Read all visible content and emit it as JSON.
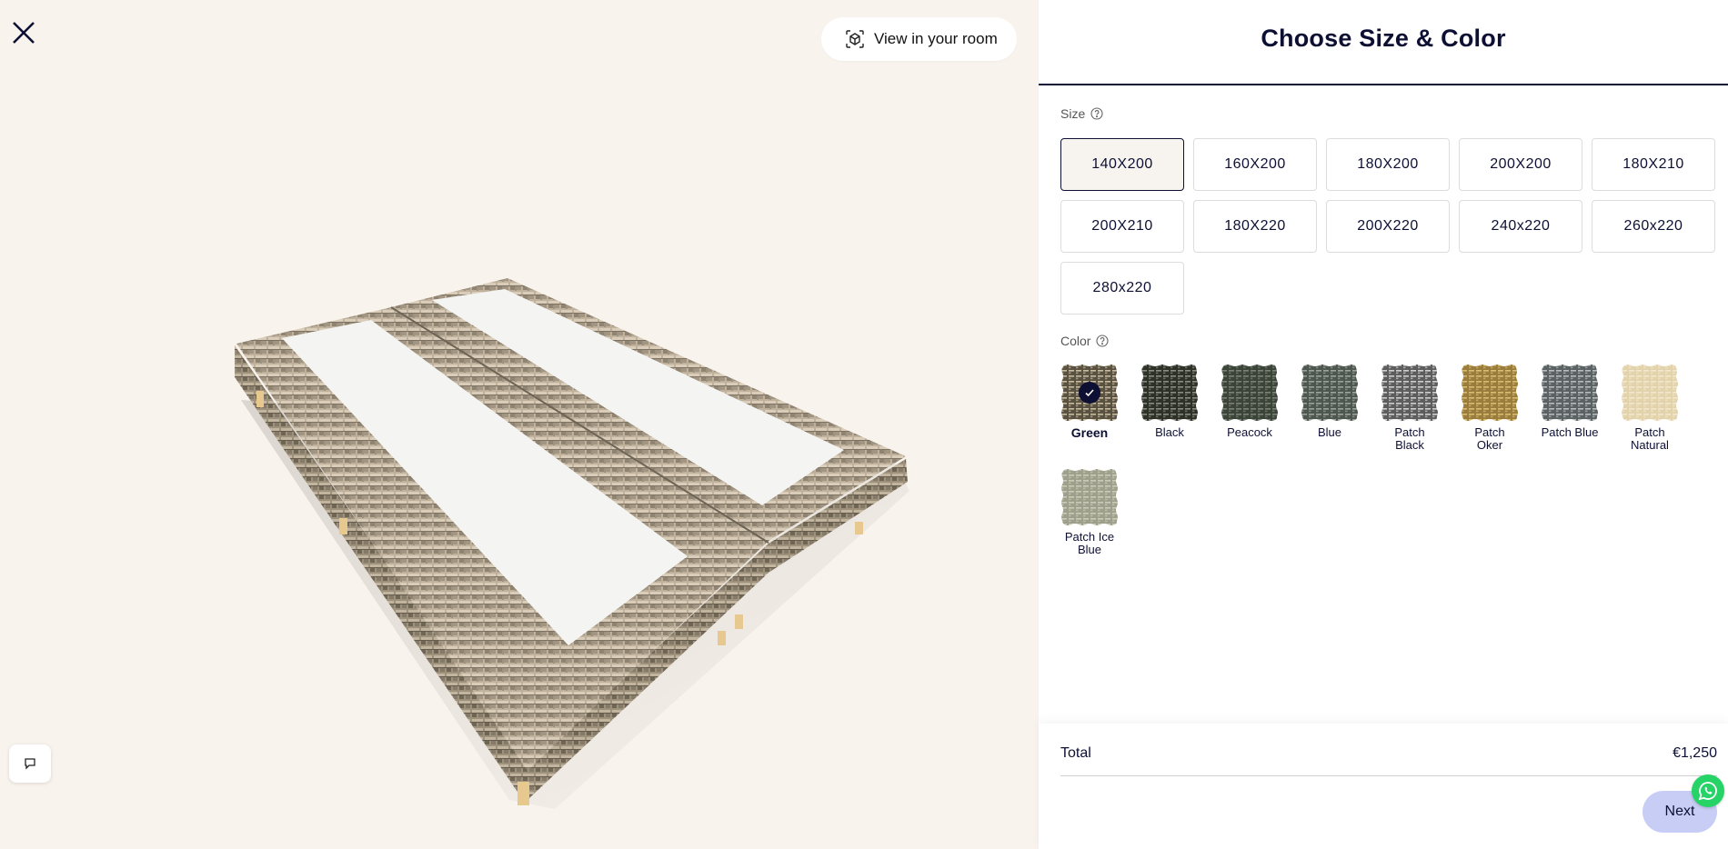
{
  "viewer": {
    "view_in_room_label": "View in your room"
  },
  "panel": {
    "title": "Choose Size & Color",
    "size_label": "Size",
    "color_label": "Color",
    "sizes": [
      "140X200",
      "160X200",
      "180X200",
      "200X200",
      "180X210",
      "200X210",
      "180X220",
      "200X220",
      "240x220",
      "260x220",
      "280x220"
    ],
    "selected_size": "140X200",
    "colors": [
      {
        "name": "Green",
        "selected": true,
        "base": "#5a5241",
        "stripe": "#c8bba0"
      },
      {
        "name": "Black",
        "selected": false,
        "base": "#2d3128",
        "stripe": "#8a8d80"
      },
      {
        "name": "Peacock",
        "selected": false,
        "base": "#3c443a",
        "stripe": "#7b8474"
      },
      {
        "name": "Blue",
        "selected": false,
        "base": "#4e5650",
        "stripe": "#9ca39a"
      },
      {
        "name": "Patch Black",
        "selected": false,
        "base": "#5d5d5d",
        "stripe": "#cfcfcf"
      },
      {
        "name": "Patch Oker",
        "selected": false,
        "base": "#9a7c3c",
        "stripe": "#d8bd72"
      },
      {
        "name": "Patch Blue",
        "selected": false,
        "base": "#5c6163",
        "stripe": "#b7bcbc"
      },
      {
        "name": "Patch Natural",
        "selected": false,
        "base": "#e3d3ad",
        "stripe": "#f3e8cc"
      },
      {
        "name": "Patch Ice Blue",
        "selected": false,
        "base": "#9ea08c",
        "stripe": "#c9cbb9"
      }
    ],
    "total_label": "Total",
    "total_value": "€1,250",
    "next_label": "Next"
  },
  "icons": {
    "close": "close-icon",
    "view_room": "ar-cube-icon",
    "help": "help-circle-icon",
    "chat": "chat-icon",
    "check": "check-icon",
    "whatsapp": "whatsapp-icon"
  },
  "colors": {
    "navy": "#0d1033",
    "viewer_bg": "#f8f3ed",
    "next_button": "#c7cdf5",
    "whatsapp": "#25d366"
  }
}
